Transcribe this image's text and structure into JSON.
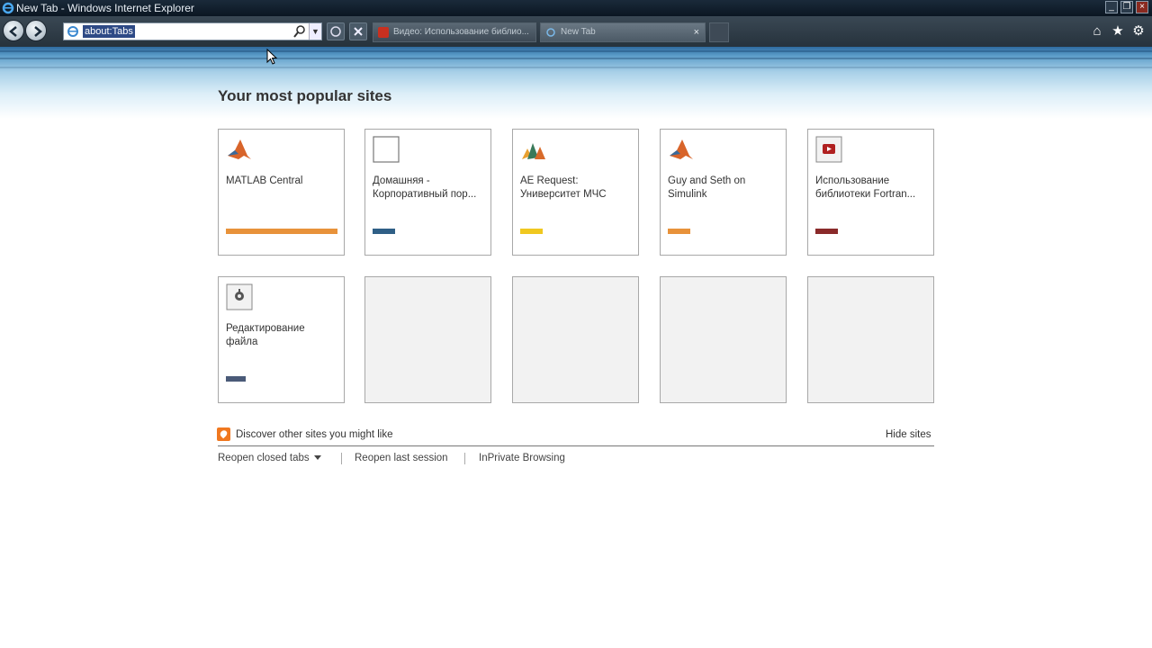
{
  "window": {
    "title": "New Tab - Windows Internet Explorer",
    "controls": [
      "minimize",
      "restore",
      "close"
    ]
  },
  "navbar": {
    "address": "about:Tabs",
    "tabs": [
      {
        "label": "Видео: Использование библио...",
        "active": false,
        "close": ""
      },
      {
        "label": "New Tab",
        "active": true,
        "close": "×"
      }
    ],
    "right_icons": [
      "home-icon",
      "favorites-star-icon",
      "tools-gear-icon"
    ]
  },
  "main": {
    "heading": "Your most popular sites",
    "tiles": [
      {
        "label": "MATLAB Central",
        "icon": "matlab-icon",
        "bar_color": "#e8923a",
        "bar_fill": 1.0
      },
      {
        "label": "Домашняя - Корпоративный пор...",
        "icon": "blank-page-icon",
        "bar_color": "#2f5f86",
        "bar_fill": 0.2
      },
      {
        "label": "AE Request: Университет МЧС",
        "icon": "matlab-variant-icon",
        "bar_color": "#f0c820",
        "bar_fill": 0.2
      },
      {
        "label": "Guy and Seth on Simulink",
        "icon": "matlab-icon",
        "bar_color": "#e8923a",
        "bar_fill": 0.2
      },
      {
        "label": "Использование библиотеки Fortran...",
        "icon": "youtube-icon",
        "bar_color": "#8a2a2a",
        "bar_fill": 0.2
      },
      {
        "label": "Редактирование файла",
        "icon": "edit-file-icon",
        "bar_color": "#4a5a78",
        "bar_fill": 0.18
      },
      {
        "label": "",
        "icon": "",
        "bar_color": "",
        "bar_fill": 0
      },
      {
        "label": "",
        "icon": "",
        "bar_color": "",
        "bar_fill": 0
      },
      {
        "label": "",
        "icon": "",
        "bar_color": "",
        "bar_fill": 0
      },
      {
        "label": "",
        "icon": "",
        "bar_color": "",
        "bar_fill": 0
      }
    ],
    "discover": "Discover other sites you might like",
    "hide_sites": "Hide sites",
    "reopen_closed": "Reopen closed tabs",
    "reopen_last": "Reopen last session",
    "inprivate": "InPrivate Browsing"
  },
  "colors": {
    "accent": "#f07820",
    "frame_dark": "#26323c"
  }
}
